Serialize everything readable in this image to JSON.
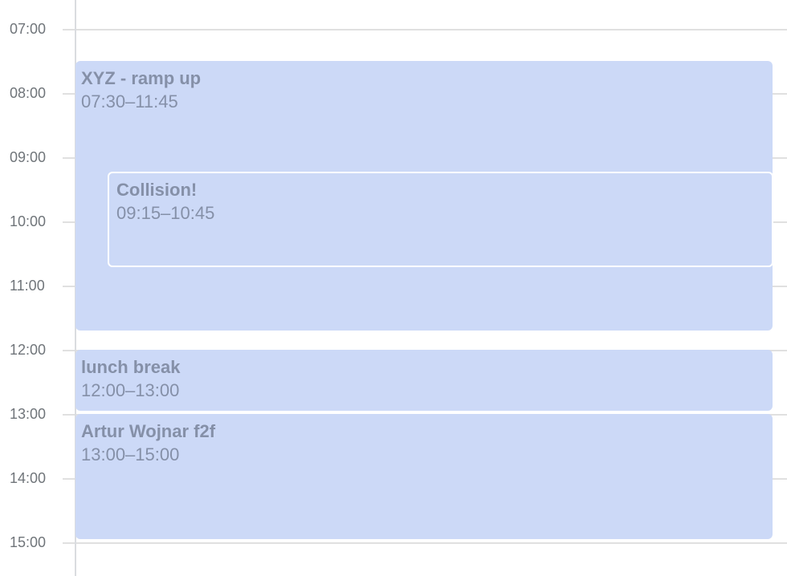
{
  "timeline": {
    "hours": [
      "07:00",
      "08:00",
      "09:00",
      "10:00",
      "11:00",
      "12:00",
      "13:00",
      "14:00",
      "15:00"
    ]
  },
  "events": [
    {
      "title": "XYZ - ramp up",
      "time": "07:30–11:45"
    },
    {
      "title": "Collision!",
      "time": "09:15–10:45"
    },
    {
      "title": "lunch break",
      "time": "12:00–13:00"
    },
    {
      "title": "Artur Wojnar f2f",
      "time": "13:00–15:00"
    }
  ],
  "colors": {
    "event_background": "#ccd9f7",
    "event_text": "#8590a8",
    "gridline": "#e0e0e0",
    "time_label": "#70757a"
  }
}
